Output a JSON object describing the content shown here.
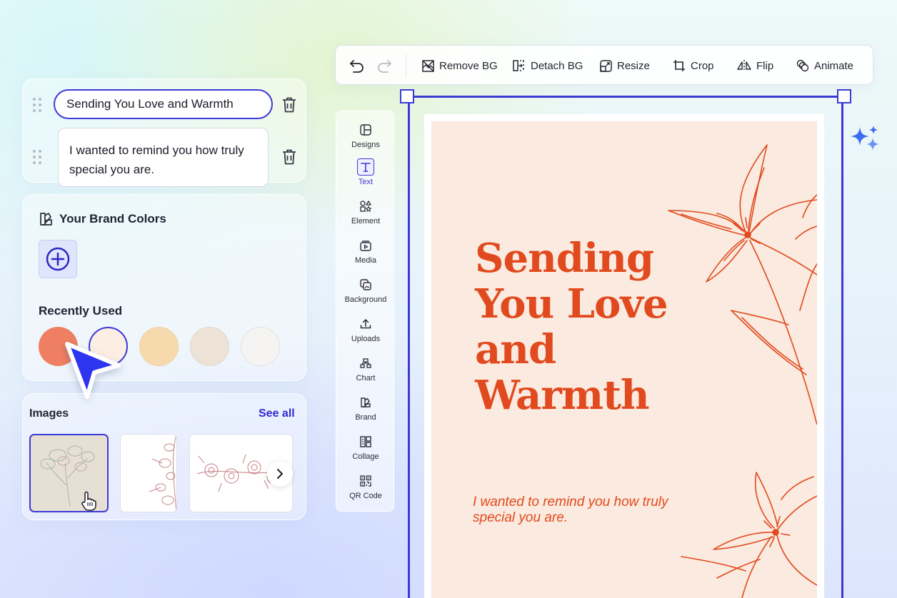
{
  "layers": {
    "title_text": "Sending You Love and Warmth",
    "body_text": "I wanted to remind you  how truly special you are."
  },
  "brand_colors": {
    "heading": "Your Brand Colors",
    "recent_heading": "Recently Used",
    "recent_swatches": [
      "#ee7f62",
      "#fdeee4",
      "#f6d9ad",
      "#ece2d6",
      "#f6f4f2"
    ]
  },
  "images": {
    "heading": "Images",
    "see_all": "See all"
  },
  "toolbar": {
    "remove_bg": "Remove BG",
    "detach_bg": "Detach BG",
    "resize": "Resize",
    "crop": "Crop",
    "flip": "Flip",
    "animate": "Animate"
  },
  "rail": {
    "designs": "Designs",
    "text": "Text",
    "element": "Element",
    "media": "Media",
    "background": "Background",
    "uploads": "Uploads",
    "chart": "Chart",
    "brand": "Brand",
    "collage": "Collage",
    "qr_code": "QR Code",
    "active": "Text"
  },
  "poster": {
    "title": "Sending You Love and Warmth",
    "subtitle": "I wanted to remind you how truly special you are."
  },
  "colors": {
    "accent": "#3c3ad6",
    "poster_text": "#e14a1e",
    "poster_bg": "#fbeadf"
  }
}
